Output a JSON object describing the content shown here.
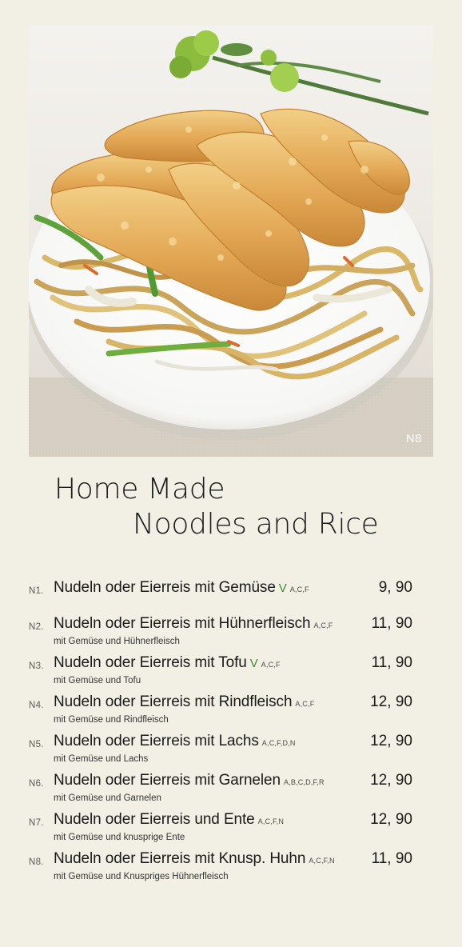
{
  "photo": {
    "code": "N8",
    "alt": "Noodles with crispy chicken"
  },
  "title": {
    "line1": "Home Made",
    "line2": "Noodles and Rice"
  },
  "items": [
    {
      "code": "N1.",
      "name": "Nudeln oder Eierreis mit Gemüse",
      "vegetarian": "V",
      "allergens": "A,C,F",
      "price": "9, 90",
      "description": ""
    },
    {
      "code": "N2.",
      "name": "Nudeln oder Eierreis mit Hühnerfleisch",
      "vegetarian": "",
      "allergens": "A,C,F",
      "price": "11, 90",
      "description": "mit Gemüse  und Hühnerfleisch"
    },
    {
      "code": "N3.",
      "name": "Nudeln oder Eierreis mit Tofu",
      "vegetarian": "V",
      "allergens": "A,C,F",
      "price": "11, 90",
      "description": "mit Gemüse und Tofu"
    },
    {
      "code": "N4.",
      "name": "Nudeln oder Eierreis mit Rindfleisch",
      "vegetarian": "",
      "allergens": "A,C,F",
      "price": "12, 90",
      "description": "mit Gemüse und Rindfleisch"
    },
    {
      "code": "N5.",
      "name": "Nudeln oder Eierreis mit Lachs",
      "vegetarian": "",
      "allergens": "A,C,F,D,N",
      "price": "12, 90",
      "description": "mit Gemüse und Lachs"
    },
    {
      "code": "N6.",
      "name": "Nudeln oder Eierreis mit Garnelen",
      "vegetarian": "",
      "allergens": "A,B,C,D,F,R",
      "price": "12, 90",
      "description": "mit Gemüse und Garnelen"
    },
    {
      "code": "N7.",
      "name": "Nudeln oder Eierreis und Ente",
      "vegetarian": "",
      "allergens": "A,C,F,N",
      "price": "12, 90",
      "description": "mit Gemüse und knusprige Ente"
    },
    {
      "code": "N8.",
      "name": "Nudeln oder Eierreis mit Knusp. Huhn",
      "vegetarian": "",
      "allergens": "A,C,F,N",
      "price": "11, 90",
      "description": "mit Gemüse und Knuspriges Hühnerfleisch"
    }
  ],
  "colors": {
    "background": "#f2efe4",
    "vegetarian_mark": "#3c8c2c"
  }
}
